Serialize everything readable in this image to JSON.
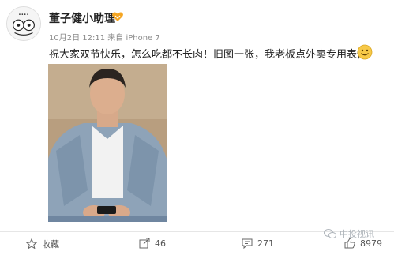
{
  "post": {
    "username": "董子健小助理",
    "date": "10月2日 12:11",
    "source_prefix": "来自",
    "source": "iPhone 7",
    "text": "祝大家双节快乐，怎么吃都不长肉！旧图一张，我老板点外卖专用表情",
    "badge_icon": "vip-heart-icon",
    "emoji_icon": "smile-emoji-icon"
  },
  "actions": {
    "favorite_label": "收藏",
    "repost_count": "46",
    "comment_count": "271",
    "like_count": "8979"
  },
  "watermark": {
    "label": "中投视讯"
  },
  "colors": {
    "username": "#222222",
    "meta": "#8a8a8a",
    "badge": "#f5a623",
    "emoji": "#f7c948",
    "action_text": "#555555"
  }
}
